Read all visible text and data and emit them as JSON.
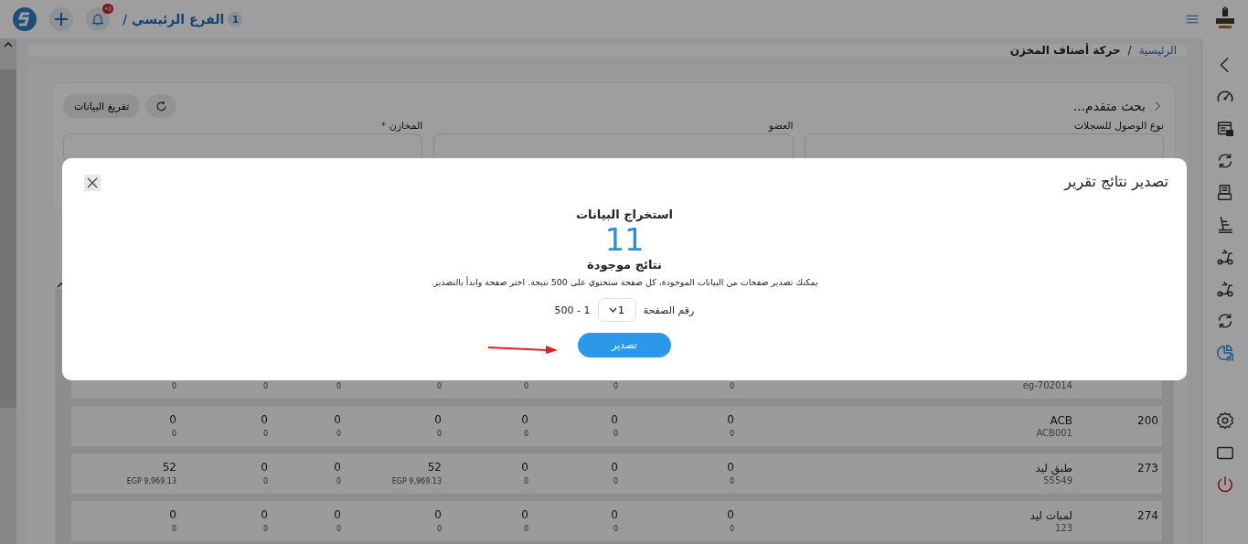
{
  "top_bar": {
    "notification_badge": "+9",
    "branch": {
      "count": "1",
      "name": "الفرع الرئيسي /"
    }
  },
  "sidebar": {
    "items": [
      {
        "selected": false
      },
      {
        "selected": false
      },
      {
        "selected": false
      },
      {
        "selected": false
      },
      {
        "selected": false
      },
      {
        "selected": false
      },
      {
        "selected": false
      },
      {
        "selected": false
      },
      {
        "selected": false
      },
      {
        "selected": true
      }
    ],
    "bottom_items": [
      {
        "kind": "settings"
      },
      {
        "kind": "screen"
      },
      {
        "kind": "logout"
      }
    ]
  },
  "breadcrumb": {
    "home": "الرئيسية",
    "separator": "/",
    "current": "حركة أصناف المخزن"
  },
  "filters": {
    "title": "بحث متقدم...",
    "clear_button": "تفريغ البيانات",
    "fields": [
      {
        "label": "نوع الوصول للسجلات"
      },
      {
        "label": "العضو"
      },
      {
        "label": "المخازن",
        "required_mark": "*"
      }
    ]
  },
  "table": {
    "rows": [
      {
        "code": "eg-702014",
        "values": [
          {
            "sub": "0"
          },
          {
            "sub": "0"
          },
          {
            "sub": "0"
          },
          {
            "sub": "0"
          },
          {
            "sub": "0"
          },
          {
            "sub": "0"
          },
          {
            "sub": "0"
          }
        ]
      },
      {
        "id": "200",
        "name": "ACB",
        "code": "ACB001",
        "values": [
          {
            "main": "0",
            "sub": "0"
          },
          {
            "main": "0",
            "sub": "0"
          },
          {
            "main": "0",
            "sub": "0"
          },
          {
            "main": "0",
            "sub": "0"
          },
          {
            "main": "0",
            "sub": "0"
          },
          {
            "main": "0",
            "sub": "0"
          },
          {
            "main": "0",
            "sub": "0"
          }
        ]
      },
      {
        "id": "273",
        "name": "طبق ليد",
        "code": "55549",
        "values": [
          {
            "main": "0",
            "sub": "0"
          },
          {
            "main": "0",
            "sub": "0"
          },
          {
            "main": "0",
            "sub": "0"
          },
          {
            "main": "52",
            "sub": "EGP 9,969.13"
          },
          {
            "main": "0",
            "sub": "0"
          },
          {
            "main": "0",
            "sub": "0"
          },
          {
            "main": "52",
            "sub": "EGP 9,969.13"
          }
        ]
      },
      {
        "id": "274",
        "name": "لمبات ليد",
        "code": "123",
        "values": [
          {
            "main": "0",
            "sub": "0"
          },
          {
            "main": "0",
            "sub": "0"
          },
          {
            "main": "0",
            "sub": "0"
          },
          {
            "main": "0",
            "sub": "0"
          },
          {
            "main": "0",
            "sub": "0"
          },
          {
            "main": "0",
            "sub": "0"
          },
          {
            "main": "0",
            "sub": "0"
          }
        ]
      }
    ]
  },
  "dialog": {
    "title": "تصدير نتائج تقرير",
    "heading": "استخراج البيانات",
    "count": "11",
    "count_label": "نتائج موجودة",
    "description": "يمكنك تصدير صفحات من البيانات الموجودة، كل صفحة ستحتوي على 500 نتيجة. اختر صفحة وابدأ بالتصدير.",
    "page_label": "رقم الصفحة",
    "page_value": "1",
    "range": "1 - 500",
    "export_button": "تصدير"
  }
}
